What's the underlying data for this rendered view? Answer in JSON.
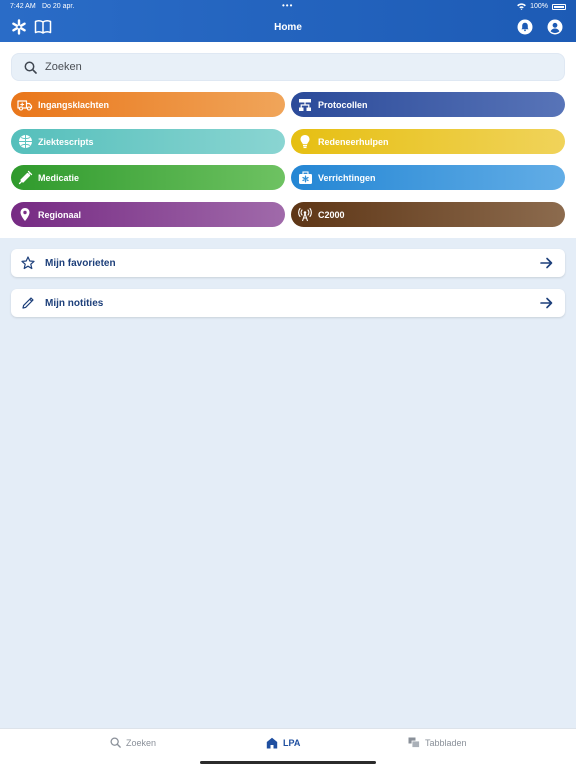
{
  "statusbar": {
    "time": "7:42 AM",
    "date": "Do 20 apr.",
    "battery": "100%"
  },
  "header": {
    "title": "Home"
  },
  "search": {
    "placeholder": "Zoeken"
  },
  "categories": [
    {
      "label": "Ingangsklachten",
      "icon": "ambulance-icon"
    },
    {
      "label": "Protocollen",
      "icon": "flowchart-icon"
    },
    {
      "label": "Ziektescripts",
      "icon": "globe-icon"
    },
    {
      "label": "Redeneerhulpen",
      "icon": "lightbulb-icon"
    },
    {
      "label": "Medicatie",
      "icon": "syringe-icon"
    },
    {
      "label": "Verrichtingen",
      "icon": "medkit-icon"
    },
    {
      "label": "Regionaal",
      "icon": "map-pin-icon"
    },
    {
      "label": "C2000",
      "icon": "antenna-icon"
    }
  ],
  "cards": [
    {
      "label": "Mijn favorieten",
      "icon": "star-icon"
    },
    {
      "label": "Mijn notities",
      "icon": "pencil-icon"
    }
  ],
  "tabbar": {
    "tabs": [
      {
        "label": "Zoeken",
        "icon": "search-icon"
      },
      {
        "label": "LPA",
        "icon": "home-icon"
      },
      {
        "label": "Tabbladen",
        "icon": "tabs-icon"
      }
    ]
  },
  "colors": {
    "header": "#2a6cc7",
    "ingangsklachten": "#ea7b1c",
    "protocollen": "#2f4f9e",
    "ziektescripts": "#5ec4c0",
    "redeneerhulpen": "#e9c61e",
    "medicatie": "#3aa232",
    "verrichtingen": "#2e8fd8",
    "regionaal": "#7a2f86",
    "c2000": "#6b3e1d"
  }
}
